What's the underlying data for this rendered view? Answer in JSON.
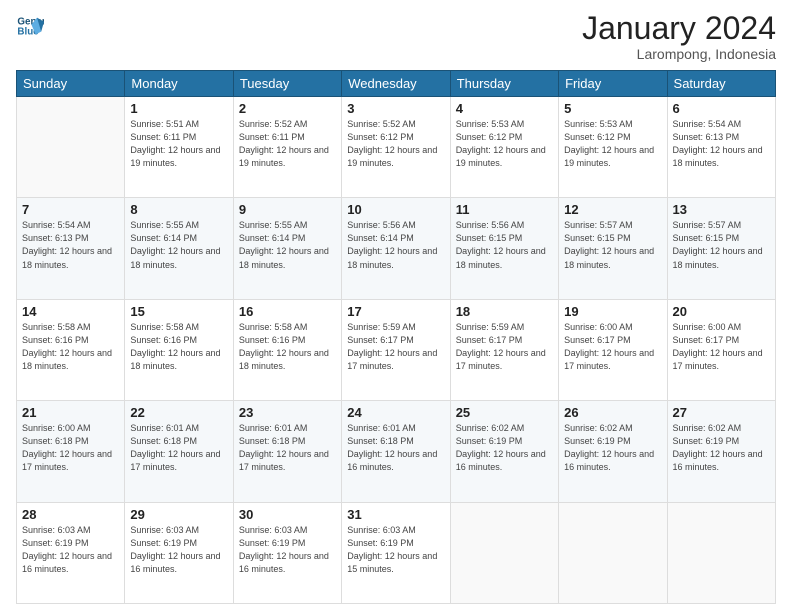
{
  "logo": {
    "line1": "General",
    "line2": "Blue"
  },
  "title": "January 2024",
  "location": "Larompong, Indonesia",
  "weekdays": [
    "Sunday",
    "Monday",
    "Tuesday",
    "Wednesday",
    "Thursday",
    "Friday",
    "Saturday"
  ],
  "days": [
    {
      "date": null
    },
    {
      "date": 1,
      "sunrise": "5:51 AM",
      "sunset": "6:11 PM",
      "daylight": "12 hours and 19 minutes."
    },
    {
      "date": 2,
      "sunrise": "5:52 AM",
      "sunset": "6:11 PM",
      "daylight": "12 hours and 19 minutes."
    },
    {
      "date": 3,
      "sunrise": "5:52 AM",
      "sunset": "6:12 PM",
      "daylight": "12 hours and 19 minutes."
    },
    {
      "date": 4,
      "sunrise": "5:53 AM",
      "sunset": "6:12 PM",
      "daylight": "12 hours and 19 minutes."
    },
    {
      "date": 5,
      "sunrise": "5:53 AM",
      "sunset": "6:12 PM",
      "daylight": "12 hours and 19 minutes."
    },
    {
      "date": 6,
      "sunrise": "5:54 AM",
      "sunset": "6:13 PM",
      "daylight": "12 hours and 18 minutes."
    },
    {
      "date": 7,
      "sunrise": "5:54 AM",
      "sunset": "6:13 PM",
      "daylight": "12 hours and 18 minutes."
    },
    {
      "date": 8,
      "sunrise": "5:55 AM",
      "sunset": "6:14 PM",
      "daylight": "12 hours and 18 minutes."
    },
    {
      "date": 9,
      "sunrise": "5:55 AM",
      "sunset": "6:14 PM",
      "daylight": "12 hours and 18 minutes."
    },
    {
      "date": 10,
      "sunrise": "5:56 AM",
      "sunset": "6:14 PM",
      "daylight": "12 hours and 18 minutes."
    },
    {
      "date": 11,
      "sunrise": "5:56 AM",
      "sunset": "6:15 PM",
      "daylight": "12 hours and 18 minutes."
    },
    {
      "date": 12,
      "sunrise": "5:57 AM",
      "sunset": "6:15 PM",
      "daylight": "12 hours and 18 minutes."
    },
    {
      "date": 13,
      "sunrise": "5:57 AM",
      "sunset": "6:15 PM",
      "daylight": "12 hours and 18 minutes."
    },
    {
      "date": 14,
      "sunrise": "5:58 AM",
      "sunset": "6:16 PM",
      "daylight": "12 hours and 18 minutes."
    },
    {
      "date": 15,
      "sunrise": "5:58 AM",
      "sunset": "6:16 PM",
      "daylight": "12 hours and 18 minutes."
    },
    {
      "date": 16,
      "sunrise": "5:58 AM",
      "sunset": "6:16 PM",
      "daylight": "12 hours and 18 minutes."
    },
    {
      "date": 17,
      "sunrise": "5:59 AM",
      "sunset": "6:17 PM",
      "daylight": "12 hours and 17 minutes."
    },
    {
      "date": 18,
      "sunrise": "5:59 AM",
      "sunset": "6:17 PM",
      "daylight": "12 hours and 17 minutes."
    },
    {
      "date": 19,
      "sunrise": "6:00 AM",
      "sunset": "6:17 PM",
      "daylight": "12 hours and 17 minutes."
    },
    {
      "date": 20,
      "sunrise": "6:00 AM",
      "sunset": "6:17 PM",
      "daylight": "12 hours and 17 minutes."
    },
    {
      "date": 21,
      "sunrise": "6:00 AM",
      "sunset": "6:18 PM",
      "daylight": "12 hours and 17 minutes."
    },
    {
      "date": 22,
      "sunrise": "6:01 AM",
      "sunset": "6:18 PM",
      "daylight": "12 hours and 17 minutes."
    },
    {
      "date": 23,
      "sunrise": "6:01 AM",
      "sunset": "6:18 PM",
      "daylight": "12 hours and 17 minutes."
    },
    {
      "date": 24,
      "sunrise": "6:01 AM",
      "sunset": "6:18 PM",
      "daylight": "12 hours and 16 minutes."
    },
    {
      "date": 25,
      "sunrise": "6:02 AM",
      "sunset": "6:19 PM",
      "daylight": "12 hours and 16 minutes."
    },
    {
      "date": 26,
      "sunrise": "6:02 AM",
      "sunset": "6:19 PM",
      "daylight": "12 hours and 16 minutes."
    },
    {
      "date": 27,
      "sunrise": "6:02 AM",
      "sunset": "6:19 PM",
      "daylight": "12 hours and 16 minutes."
    },
    {
      "date": 28,
      "sunrise": "6:03 AM",
      "sunset": "6:19 PM",
      "daylight": "12 hours and 16 minutes."
    },
    {
      "date": 29,
      "sunrise": "6:03 AM",
      "sunset": "6:19 PM",
      "daylight": "12 hours and 16 minutes."
    },
    {
      "date": 30,
      "sunrise": "6:03 AM",
      "sunset": "6:19 PM",
      "daylight": "12 hours and 16 minutes."
    },
    {
      "date": 31,
      "sunrise": "6:03 AM",
      "sunset": "6:19 PM",
      "daylight": "12 hours and 15 minutes."
    }
  ],
  "labels": {
    "sunrise": "Sunrise:",
    "sunset": "Sunset:",
    "daylight": "Daylight:"
  }
}
